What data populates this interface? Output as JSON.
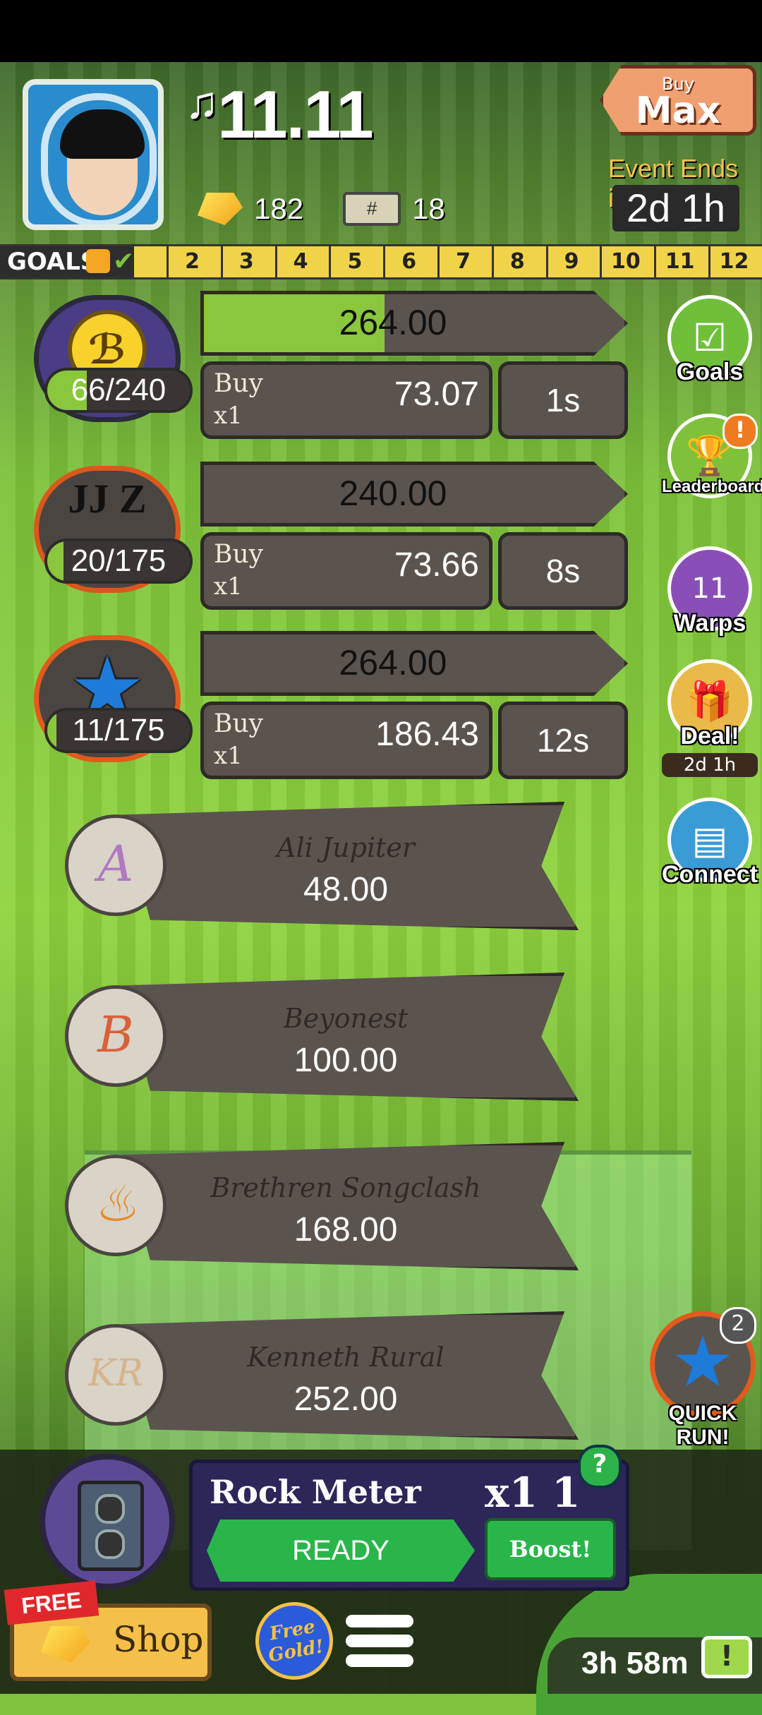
{
  "header": {
    "score": "11.11",
    "score_icon": "music-note-icon",
    "gold_count": "182",
    "ticket_count": "18",
    "ticket_glyph": "#",
    "buy_max_small": "Buy",
    "buy_max_big": "Max",
    "event_label": "Event Ends in:",
    "event_time": "2d 1h"
  },
  "goals_bar": {
    "label": "GOALS",
    "numbers": [
      "2",
      "3",
      "4",
      "5",
      "6",
      "7",
      "8",
      "9",
      "10",
      "11",
      "12"
    ]
  },
  "artists": [
    {
      "logo": "ℬ",
      "progress_text": "66/240",
      "progress": 0.275,
      "revenue": "264.00",
      "revenue_progress": 0.43,
      "buy_label": "Buy",
      "buy_mult": "x1",
      "cost": "73.07",
      "time": "1s"
    },
    {
      "logo": "JJ Z",
      "progress_text": "20/175",
      "progress": 0.114,
      "revenue": "240.00",
      "revenue_progress": 0.0,
      "buy_label": "Buy",
      "buy_mult": "x1",
      "cost": "73.66",
      "time": "8s"
    },
    {
      "logo": "★",
      "progress_text": "11/175",
      "progress": 0.063,
      "revenue": "264.00",
      "revenue_progress": 0.0,
      "buy_label": "Buy",
      "buy_mult": "x1",
      "cost": "186.43",
      "time": "12s"
    }
  ],
  "locked_artists": [
    {
      "name": "Ali Jupiter",
      "price": "48.00",
      "glyph": "A",
      "color": "#b07ac0"
    },
    {
      "name": "Beyonest",
      "price": "100.00",
      "glyph": "B",
      "color": "#d9603a"
    },
    {
      "name": "Brethren Songclash",
      "price": "168.00",
      "glyph": "♨",
      "color": "#e68a24"
    },
    {
      "name": "Kenneth Rural",
      "price": "252.00",
      "glyph": "KR",
      "color": "#d6b48c"
    }
  ],
  "side_buttons": {
    "goals": "Goals",
    "leaderboard": "Leaderboard",
    "leaderboard_alert": "!",
    "warps": "Warps",
    "warps_count": "11",
    "deal": "Deal!",
    "deal_time": "2d 1h",
    "connect": "Connect"
  },
  "quick_run": {
    "label": "QUICK RUN!",
    "count": "2"
  },
  "rock_meter": {
    "title": "Rock Meter",
    "multiplier": "x1 1",
    "help": "?",
    "ready": "READY",
    "boost": "Boost!"
  },
  "bottom": {
    "free_tag": "FREE",
    "shop": "Shop",
    "free_gold": "Free Gold!",
    "timer": "3h 58m",
    "tv_icon": "!"
  },
  "colors": {
    "panel": "#5b544e",
    "accent_green": "#8bc73d",
    "button_green": "#2ab54a",
    "gold": "#f5c04a"
  }
}
